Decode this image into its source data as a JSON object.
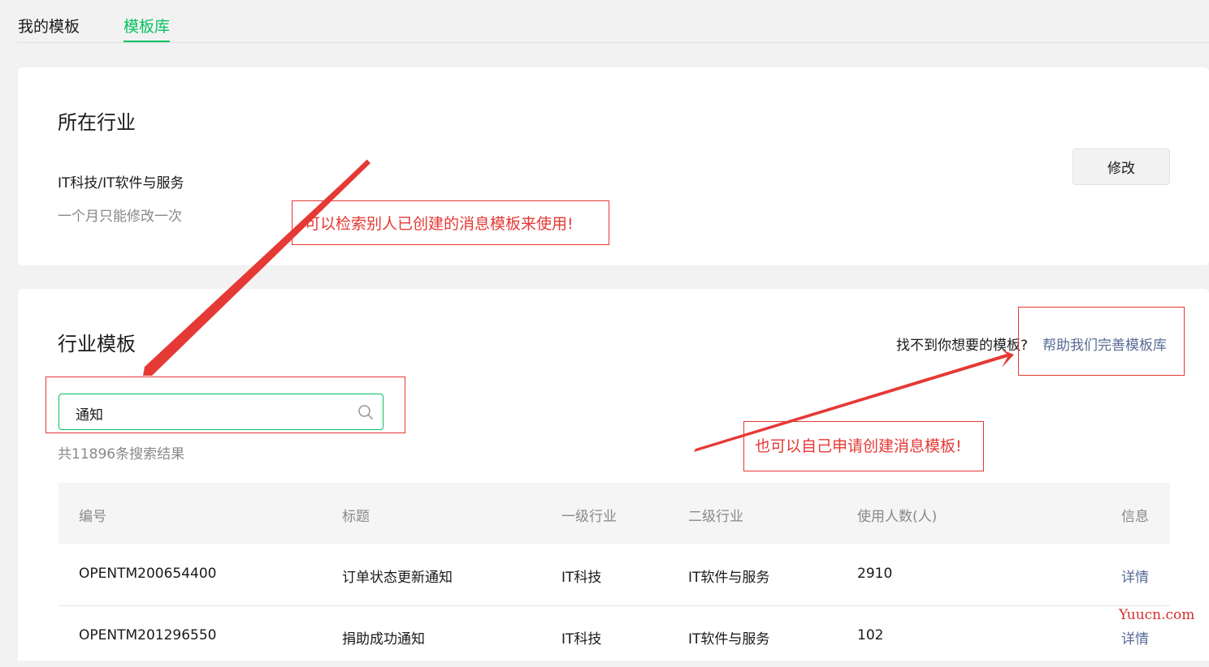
{
  "tabs": [
    {
      "label": "我的模板"
    },
    {
      "label": "模板库"
    }
  ],
  "industry_section": {
    "title": "所在行业",
    "industry": "IT科技/IT软件与服务",
    "hint": "一个月只能修改一次",
    "modify_button": "修改"
  },
  "templates_section": {
    "title": "行业模板",
    "help_question": "找不到你想要的模板?",
    "help_link": "帮助我们完善模板库",
    "search": {
      "value": "通知",
      "icon": "search-icon"
    },
    "result_count": "共11896条搜索结果",
    "table": {
      "headers": [
        "编号",
        "标题",
        "一级行业",
        "二级行业",
        "使用人数(人)",
        "信息"
      ],
      "rows": [
        [
          "OPENTM200654400",
          "订单状态更新通知",
          "IT科技",
          "IT软件与服务",
          "2910",
          "详情"
        ],
        [
          "OPENTM201296550",
          "捐助成功通知",
          "IT科技",
          "IT软件与服务",
          "102",
          "详情"
        ]
      ]
    }
  },
  "annotations": {
    "note1": "可以检索别人已创建的消息模板来使用!",
    "note2": "也可以自己申请创建消息模板!"
  },
  "watermark": "Yuucn.com",
  "colors": {
    "accent": "#07c160",
    "link": "#576b95",
    "annotation": "#e53935"
  }
}
